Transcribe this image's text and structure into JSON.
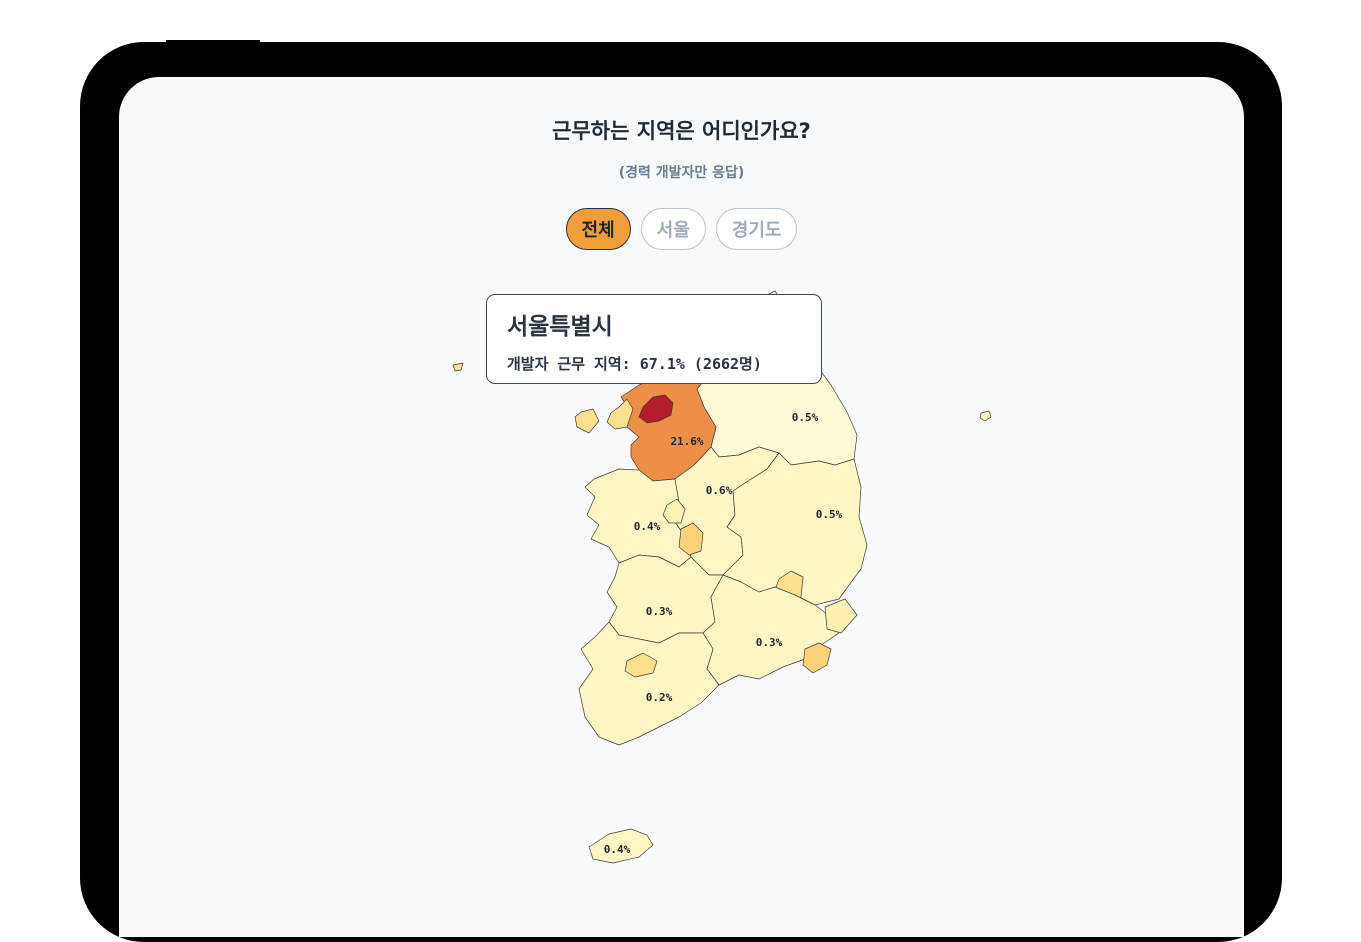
{
  "question": {
    "title": "근무하는 지역은 어디인가요?",
    "subtitle": "(경력 개발자만 응답)"
  },
  "filters": [
    {
      "label": "전체",
      "active": true
    },
    {
      "label": "서울",
      "active": false
    },
    {
      "label": "경기도",
      "active": false
    }
  ],
  "tooltip": {
    "region": "서울특별시",
    "line": "개발자 근무 지역: 67.1% (2662명)"
  },
  "map": {
    "regions": [
      {
        "id": "seoul",
        "value_label": "",
        "color": "#b41d2b"
      },
      {
        "id": "gyeonggi",
        "value_label": "21.6%",
        "color": "#ee8f47"
      },
      {
        "id": "gangwon",
        "value_label": "0.5%",
        "color": "#fffbd6"
      },
      {
        "id": "chungbuk",
        "value_label": "0.6%",
        "color": "#fff6c4"
      },
      {
        "id": "chungnam",
        "value_label": "0.4%",
        "color": "#fff6c4"
      },
      {
        "id": "gyeongbuk",
        "value_label": "0.5%",
        "color": "#fff6c4"
      },
      {
        "id": "jeonbuk",
        "value_label": "0.3%",
        "color": "#fff6c4"
      },
      {
        "id": "gyeongnam",
        "value_label": "0.3%",
        "color": "#fff6c4"
      },
      {
        "id": "jeonnam",
        "value_label": "0.2%",
        "color": "#fff6c4"
      },
      {
        "id": "jeju",
        "value_label": "0.4%",
        "color": "#fff6c4"
      },
      {
        "id": "incheon",
        "value_label": "",
        "color": "#fde08e"
      },
      {
        "id": "daejeon",
        "value_label": "",
        "color": "#fdd27a"
      },
      {
        "id": "daegu",
        "value_label": "",
        "color": "#fde08e"
      },
      {
        "id": "busan",
        "value_label": "",
        "color": "#fdd27a"
      },
      {
        "id": "ulsan",
        "value_label": "",
        "color": "#fff1b3"
      },
      {
        "id": "gwangju",
        "value_label": "",
        "color": "#fde08e"
      },
      {
        "id": "sejong",
        "value_label": "",
        "color": "#fff1b3"
      }
    ]
  }
}
